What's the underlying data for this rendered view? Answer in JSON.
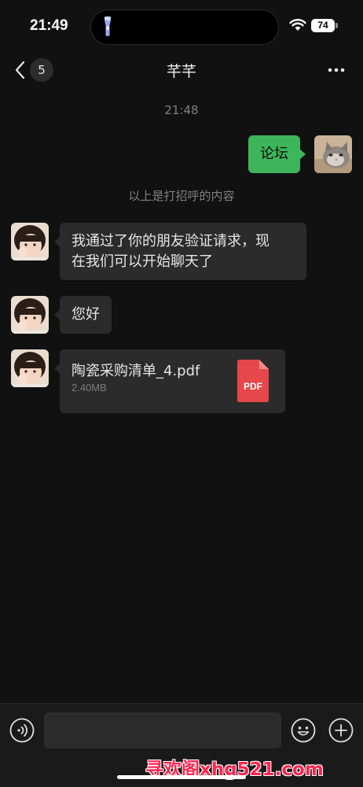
{
  "status_bar": {
    "time": "21:49",
    "battery": "74"
  },
  "nav": {
    "back_count": "5",
    "title": "芊芊"
  },
  "chat": {
    "timestamp": "21:48",
    "sent_message": "论坛",
    "system_notice": "以上是打招呼的内容",
    "received": [
      {
        "lines": [
          "我通过了你的朋友验证请求，现",
          "在我们可以开始聊天了"
        ]
      },
      {
        "lines": [
          "您好"
        ]
      }
    ],
    "file": {
      "name": "陶瓷采购清单_4.pdf",
      "size": "2.40MB",
      "icon_label": "PDF"
    }
  },
  "input_bar": {
    "placeholder": ""
  },
  "watermark": "寻欢阁xhg521.com",
  "colors": {
    "background": "#111111",
    "sent_bubble": "#3eb55a",
    "received_bubble": "#2b2b2b",
    "pdf_red": "#e5474b",
    "watermark": "#ff2650"
  },
  "icons": [
    "flashlight-icon",
    "wifi-icon",
    "battery-icon",
    "back-chevron-icon",
    "more-icon",
    "pdf-icon",
    "voice-icon",
    "emoji-icon",
    "plus-icon"
  ]
}
